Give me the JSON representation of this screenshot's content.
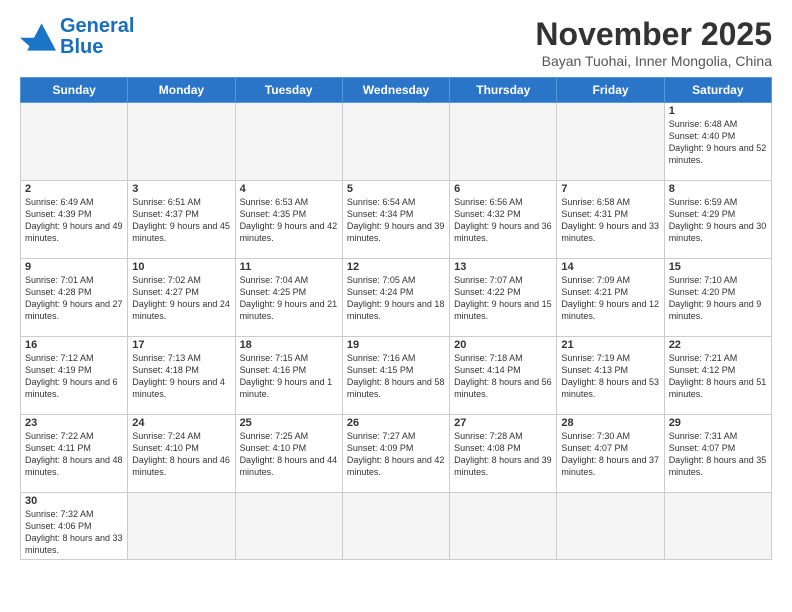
{
  "header": {
    "logo_general": "General",
    "logo_blue": "Blue",
    "month_title": "November 2025",
    "location": "Bayan Tuohai, Inner Mongolia, China"
  },
  "weekdays": [
    "Sunday",
    "Monday",
    "Tuesday",
    "Wednesday",
    "Thursday",
    "Friday",
    "Saturday"
  ],
  "weeks": [
    [
      {
        "day": "",
        "info": ""
      },
      {
        "day": "",
        "info": ""
      },
      {
        "day": "",
        "info": ""
      },
      {
        "day": "",
        "info": ""
      },
      {
        "day": "",
        "info": ""
      },
      {
        "day": "",
        "info": ""
      },
      {
        "day": "1",
        "info": "Sunrise: 6:48 AM\nSunset: 4:40 PM\nDaylight: 9 hours\nand 52 minutes."
      }
    ],
    [
      {
        "day": "2",
        "info": "Sunrise: 6:49 AM\nSunset: 4:39 PM\nDaylight: 9 hours\nand 49 minutes."
      },
      {
        "day": "3",
        "info": "Sunrise: 6:51 AM\nSunset: 4:37 PM\nDaylight: 9 hours\nand 45 minutes."
      },
      {
        "day": "4",
        "info": "Sunrise: 6:53 AM\nSunset: 4:35 PM\nDaylight: 9 hours\nand 42 minutes."
      },
      {
        "day": "5",
        "info": "Sunrise: 6:54 AM\nSunset: 4:34 PM\nDaylight: 9 hours\nand 39 minutes."
      },
      {
        "day": "6",
        "info": "Sunrise: 6:56 AM\nSunset: 4:32 PM\nDaylight: 9 hours\nand 36 minutes."
      },
      {
        "day": "7",
        "info": "Sunrise: 6:58 AM\nSunset: 4:31 PM\nDaylight: 9 hours\nand 33 minutes."
      },
      {
        "day": "8",
        "info": "Sunrise: 6:59 AM\nSunset: 4:29 PM\nDaylight: 9 hours\nand 30 minutes."
      }
    ],
    [
      {
        "day": "9",
        "info": "Sunrise: 7:01 AM\nSunset: 4:28 PM\nDaylight: 9 hours\nand 27 minutes."
      },
      {
        "day": "10",
        "info": "Sunrise: 7:02 AM\nSunset: 4:27 PM\nDaylight: 9 hours\nand 24 minutes."
      },
      {
        "day": "11",
        "info": "Sunrise: 7:04 AM\nSunset: 4:25 PM\nDaylight: 9 hours\nand 21 minutes."
      },
      {
        "day": "12",
        "info": "Sunrise: 7:05 AM\nSunset: 4:24 PM\nDaylight: 9 hours\nand 18 minutes."
      },
      {
        "day": "13",
        "info": "Sunrise: 7:07 AM\nSunset: 4:22 PM\nDaylight: 9 hours\nand 15 minutes."
      },
      {
        "day": "14",
        "info": "Sunrise: 7:09 AM\nSunset: 4:21 PM\nDaylight: 9 hours\nand 12 minutes."
      },
      {
        "day": "15",
        "info": "Sunrise: 7:10 AM\nSunset: 4:20 PM\nDaylight: 9 hours\nand 9 minutes."
      }
    ],
    [
      {
        "day": "16",
        "info": "Sunrise: 7:12 AM\nSunset: 4:19 PM\nDaylight: 9 hours\nand 6 minutes."
      },
      {
        "day": "17",
        "info": "Sunrise: 7:13 AM\nSunset: 4:18 PM\nDaylight: 9 hours\nand 4 minutes."
      },
      {
        "day": "18",
        "info": "Sunrise: 7:15 AM\nSunset: 4:16 PM\nDaylight: 9 hours\nand 1 minute."
      },
      {
        "day": "19",
        "info": "Sunrise: 7:16 AM\nSunset: 4:15 PM\nDaylight: 8 hours\nand 58 minutes."
      },
      {
        "day": "20",
        "info": "Sunrise: 7:18 AM\nSunset: 4:14 PM\nDaylight: 8 hours\nand 56 minutes."
      },
      {
        "day": "21",
        "info": "Sunrise: 7:19 AM\nSunset: 4:13 PM\nDaylight: 8 hours\nand 53 minutes."
      },
      {
        "day": "22",
        "info": "Sunrise: 7:21 AM\nSunset: 4:12 PM\nDaylight: 8 hours\nand 51 minutes."
      }
    ],
    [
      {
        "day": "23",
        "info": "Sunrise: 7:22 AM\nSunset: 4:11 PM\nDaylight: 8 hours\nand 48 minutes."
      },
      {
        "day": "24",
        "info": "Sunrise: 7:24 AM\nSunset: 4:10 PM\nDaylight: 8 hours\nand 46 minutes."
      },
      {
        "day": "25",
        "info": "Sunrise: 7:25 AM\nSunset: 4:10 PM\nDaylight: 8 hours\nand 44 minutes."
      },
      {
        "day": "26",
        "info": "Sunrise: 7:27 AM\nSunset: 4:09 PM\nDaylight: 8 hours\nand 42 minutes."
      },
      {
        "day": "27",
        "info": "Sunrise: 7:28 AM\nSunset: 4:08 PM\nDaylight: 8 hours\nand 39 minutes."
      },
      {
        "day": "28",
        "info": "Sunrise: 7:30 AM\nSunset: 4:07 PM\nDaylight: 8 hours\nand 37 minutes."
      },
      {
        "day": "29",
        "info": "Sunrise: 7:31 AM\nSunset: 4:07 PM\nDaylight: 8 hours\nand 35 minutes."
      }
    ],
    [
      {
        "day": "30",
        "info": "Sunrise: 7:32 AM\nSunset: 4:06 PM\nDaylight: 8 hours\nand 33 minutes."
      },
      {
        "day": "",
        "info": ""
      },
      {
        "day": "",
        "info": ""
      },
      {
        "day": "",
        "info": ""
      },
      {
        "day": "",
        "info": ""
      },
      {
        "day": "",
        "info": ""
      },
      {
        "day": "",
        "info": ""
      }
    ]
  ]
}
